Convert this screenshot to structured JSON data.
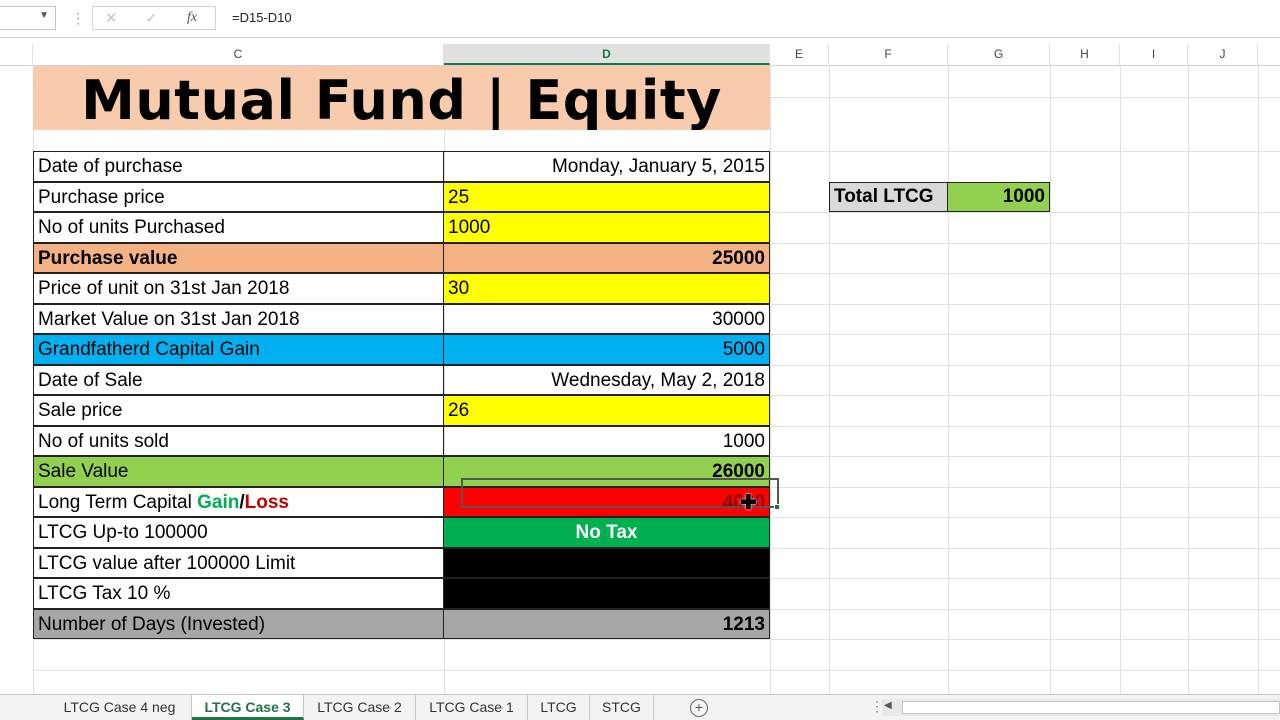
{
  "formula_bar": {
    "formula": "=D15-D10",
    "cancel_icon": "close-icon",
    "enter_icon": "check-icon",
    "function_label": "fx"
  },
  "columns": [
    "C",
    "D",
    "E",
    "F",
    "G",
    "H",
    "I",
    "J"
  ],
  "active_column": "D",
  "title": "Mutual Fund | Equity",
  "rows": [
    {
      "label": "Date of purchase",
      "value": "Monday, January 5, 2015"
    },
    {
      "label": "Purchase price",
      "value": "25"
    },
    {
      "label": "No of units Purchased",
      "value": "1000"
    },
    {
      "label": "Purchase value",
      "value": "25000"
    },
    {
      "label": "Price of unit on 31st Jan 2018",
      "value": "30"
    },
    {
      "label": "Market  Value on 31st Jan 2018",
      "value": "30000"
    },
    {
      "label": "Grandfatherd Capital Gain",
      "value": "5000"
    },
    {
      "label": "Date of Sale",
      "value": "Wednesday, May 2, 2018"
    },
    {
      "label": "Sale price",
      "value": "26"
    },
    {
      "label": "No of units sold",
      "value": "1000"
    },
    {
      "label": "Sale Value",
      "value": "26000"
    },
    {
      "label_prefix": "Long Term Capital ",
      "label_gain": "Gain",
      "label_slash": "/",
      "label_loss": "Loss",
      "value": "4000"
    },
    {
      "label": "LTCG Up-to 100000",
      "value": "No Tax"
    },
    {
      "label": "LTCG value after 100000 Limit",
      "value": ""
    },
    {
      "label": "LTCG Tax 10 %",
      "value": ""
    },
    {
      "label": "Number of Days (Invested)",
      "value": "1213"
    }
  ],
  "summary": {
    "label": "Total LTCG",
    "value": "1000"
  },
  "sheet_tabs": [
    "LTCG Case 4 neg",
    "LTCG Case 3",
    "LTCG Case 2",
    "LTCG Case 1",
    "LTCG",
    "STCG"
  ],
  "active_tab": "LTCG Case 3",
  "colors": {
    "title_bg": "#f8cbad",
    "purchase_value_bg": "#f4b183",
    "input_yellow": "#ffff00",
    "grandfathered_bg": "#00b0f0",
    "sale_value_bg": "#92d050",
    "gain_loss_bg": "#ff0000",
    "no_tax_bg": "#00b050",
    "black_cell": "#000000",
    "days_bg": "#a6a6a6",
    "accent": "#217346"
  }
}
